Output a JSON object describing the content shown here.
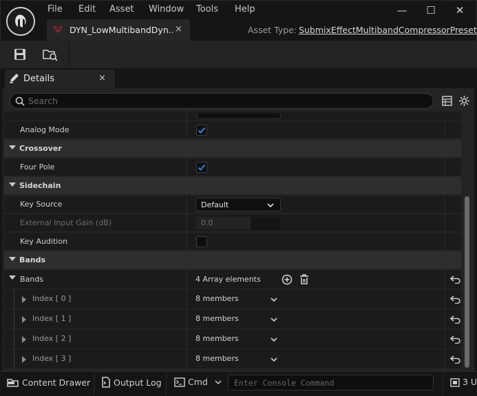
{
  "menu": [
    "File",
    "Edit",
    "Asset",
    "Window",
    "Tools",
    "Help"
  ],
  "window_controls": {
    "minimize": "—",
    "maximize": "☐",
    "close": "✕"
  },
  "doc_tab": {
    "label": "DYN_LowMultibandDyn...",
    "close": "×",
    "icon": "asset-icon"
  },
  "asset_type": {
    "label": "Asset Type:",
    "value": "SubmixEffectMultibandCompressorPreset"
  },
  "toolbar": {
    "save_icon": "save-icon",
    "browse_icon": "browse-to-asset-icon"
  },
  "details_tab": {
    "label": "Details",
    "close": "×"
  },
  "search": {
    "placeholder": "Search"
  },
  "rows": [
    {
      "label": "Analog Mode",
      "checked": true
    },
    {
      "label": "Crossover"
    },
    {
      "label": "Four Pole",
      "checked": true
    },
    {
      "label": "Sidechain"
    },
    {
      "label": "Key Source",
      "value": "Default"
    },
    {
      "label": "External Input Gain (dB)",
      "value": "0.0"
    },
    {
      "label": "Key Audition",
      "checked": false
    },
    {
      "label": "Bands"
    },
    {
      "label": "Bands",
      "value": "4 Array elements"
    },
    {
      "label": "Index [ 0 ]",
      "value": "8 members"
    },
    {
      "label": "Index [ 1 ]",
      "value": "8 members"
    },
    {
      "label": "Index [ 2 ]",
      "value": "8 members"
    },
    {
      "label": "Index [ 3 ]",
      "value": "8 members"
    }
  ],
  "statusbar": {
    "content_drawer": "Content Drawer",
    "output_log": "Output Log",
    "cmd": "Cmd",
    "console_placeholder": "Enter Console Command",
    "right": "3 U"
  },
  "colors": {
    "accent": "#2d7bd6",
    "panel": "#242424",
    "category": "#2e2e2e"
  }
}
